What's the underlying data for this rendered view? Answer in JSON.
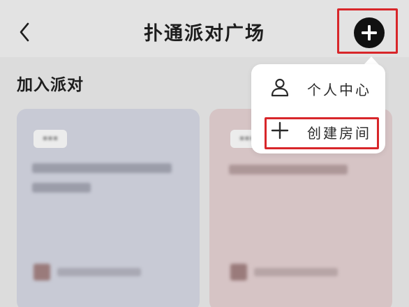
{
  "nav": {
    "title": "扑通派对广场",
    "back_icon": "chevron-left-icon",
    "plus_icon": "plus-circle-icon"
  },
  "section": {
    "title": "加入派对"
  },
  "menu": {
    "items": [
      {
        "label": "个人中心",
        "icon": "person-icon"
      },
      {
        "label": "创建房间",
        "icon": "plus-icon"
      }
    ]
  },
  "colors": {
    "highlight": "#d8262a",
    "plus_button_bg": "#111111",
    "card_a_bg": "#c8cad5",
    "card_b_bg": "#d6c4c5",
    "popup_bg": "#ffffff"
  }
}
